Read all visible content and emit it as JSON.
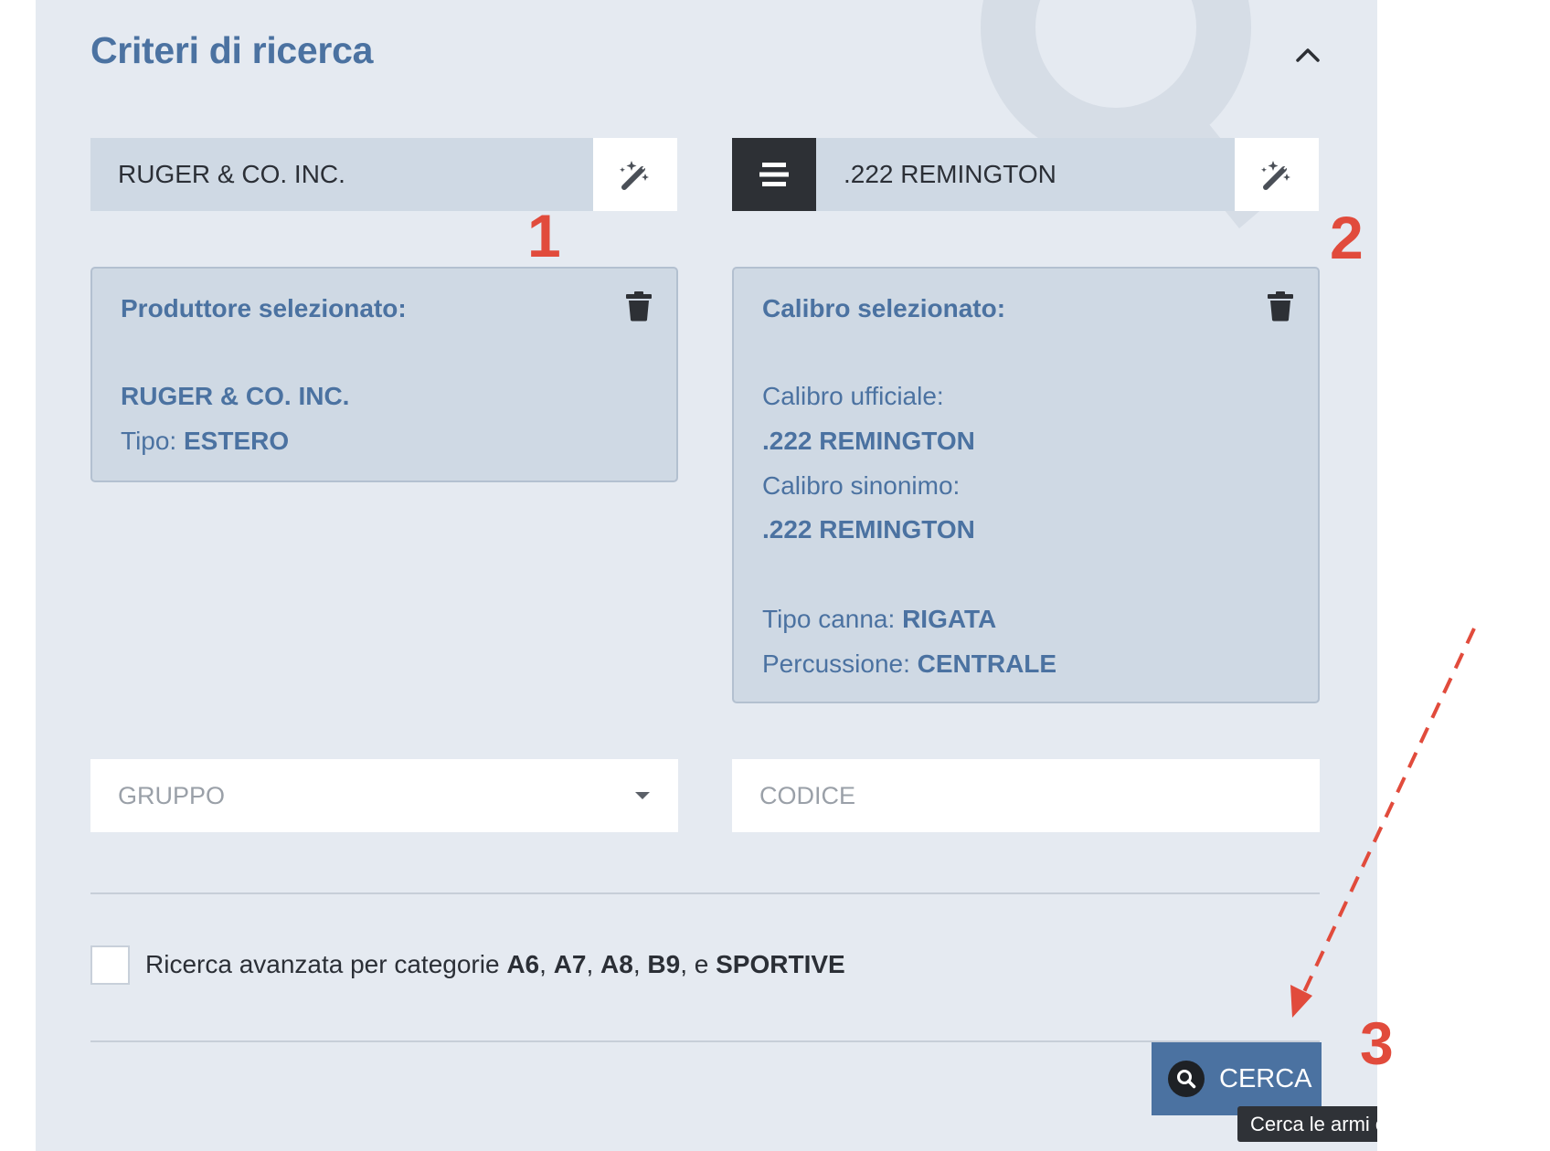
{
  "panel": {
    "title": "Criteri di ricerca",
    "collapse_icon": "chevron-up-icon"
  },
  "manufacturer_field": {
    "value": "RUGER & CO. INC.",
    "magic_icon": "magic-wand-icon"
  },
  "caliber_field": {
    "menu_icon": "menu-icon",
    "value": ".222 REMINGTON",
    "magic_icon": "magic-wand-icon"
  },
  "manufacturer_card": {
    "heading": "Produttore selezionato:",
    "name": "RUGER & CO. INC.",
    "type_label": "Tipo: ",
    "type_value": "ESTERO",
    "delete_icon": "trash-icon"
  },
  "caliber_card": {
    "heading": "Calibro selezionato:",
    "official_label": "Calibro ufficiale:",
    "official_value": ".222 REMINGTON",
    "synonym_label": "Calibro sinonimo:",
    "synonym_value": ".222 REMINGTON",
    "barrel_label": "Tipo canna: ",
    "barrel_value": "RIGATA",
    "percussion_label": "Percussione: ",
    "percussion_value": "CENTRALE",
    "delete_icon": "trash-icon"
  },
  "group_select": {
    "placeholder": "GRUPPO",
    "arrow_icon": "caret-down-icon"
  },
  "code_input": {
    "placeholder": "CODICE"
  },
  "advanced_search": {
    "checked": false,
    "text_prefix": "Ricerca avanzata per categorie ",
    "cat1": "A6",
    "sep1": ", ",
    "cat2": "A7",
    "sep2": ", ",
    "cat3": "A8",
    "sep3": ", ",
    "cat4": "B9",
    "sep4": ", e ",
    "cat5": "SPORTIVE"
  },
  "search_button": {
    "label": "CERCA",
    "icon": "search-icon",
    "tooltip": "Cerca le armi classificate"
  },
  "annotations": {
    "marker1": "1",
    "marker2": "2",
    "marker3": "3"
  },
  "colors": {
    "panel_bg": "#e5eaf1",
    "accent": "#4b72a1",
    "field_bg": "#cfd9e4",
    "dark": "#2d3035",
    "annotation_red": "#e14b3c"
  }
}
